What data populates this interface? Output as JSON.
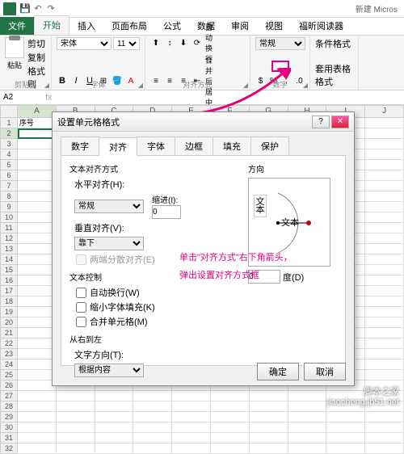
{
  "app": {
    "title": "新建 Micros"
  },
  "ribbon": {
    "tabs": [
      "文件",
      "开始",
      "插入",
      "页面布局",
      "公式",
      "数据",
      "审阅",
      "视图",
      "福昕阅读器"
    ],
    "active": "开始",
    "clipboard": {
      "label": "剪贴板",
      "paste": "粘贴",
      "cut": "剪切",
      "copy": "复制",
      "fmtpainter": "格式刷"
    },
    "font": {
      "label": "字体",
      "name": "宋体",
      "size": "11"
    },
    "alignment": {
      "label": "对齐方式",
      "wrap": "自动换行",
      "merge": "合并后居中"
    },
    "number": {
      "label": "数字",
      "format": "常规"
    },
    "styles": {
      "cond": "条件格式",
      "tbl": "套用表格格式"
    }
  },
  "namebox": {
    "ref": "A2"
  },
  "sheet": {
    "cols": [
      "A",
      "B",
      "C",
      "D",
      "E",
      "F",
      "G",
      "H",
      "I",
      "J"
    ],
    "a1": "序号"
  },
  "dialog": {
    "title": "设置单元格格式",
    "tabs": [
      "数字",
      "对齐",
      "字体",
      "边框",
      "填充",
      "保护"
    ],
    "active": "对齐",
    "sect_textalign": "文本对齐方式",
    "halign_label": "水平对齐(H):",
    "halign_value": "常规",
    "indent_label": "缩进(I):",
    "indent_value": "0",
    "valign_label": "垂直对齐(V):",
    "valign_value": "靠下",
    "justify": "两端分散对齐(E)",
    "sect_textctrl": "文本控制",
    "wrap": "自动换行(W)",
    "shrink": "缩小字体填充(K)",
    "merge": "合并单元格(M)",
    "sect_rtl": "从右到左",
    "textdir_label": "文字方向(T):",
    "textdir_value": "根据内容",
    "orient_label": "方向",
    "orient_vtext": "文本",
    "orient_htext": "文本",
    "degree_value": "0",
    "degree_unit": "度(D)",
    "ok": "确定",
    "cancel": "取消"
  },
  "annotation": {
    "line1": "单击\"对齐方式\"右下角箭头，",
    "line2": "弹出设置对齐方式框"
  },
  "watermark": {
    "l1": "脚本之家",
    "l2": "jiaocheng.jb51.net"
  }
}
